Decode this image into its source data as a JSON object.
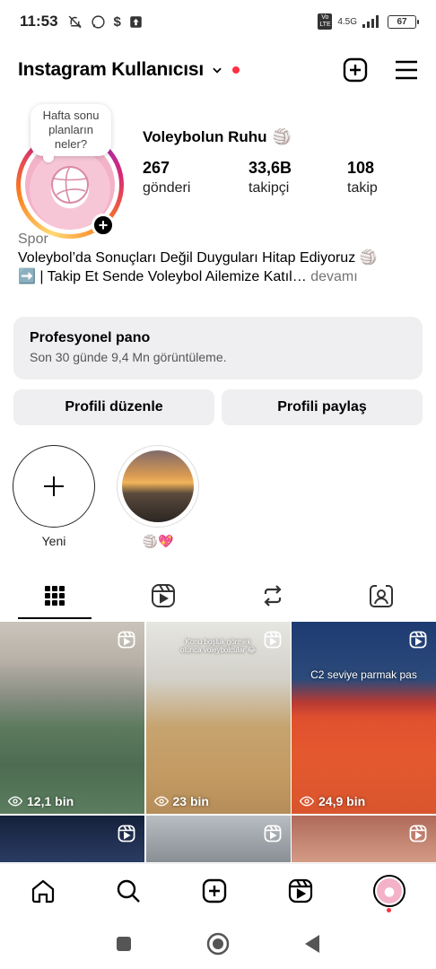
{
  "status_bar": {
    "time": "11:53",
    "network": "4.5G",
    "lte": "Vo LTE",
    "battery": "67"
  },
  "header": {
    "username": "Instagram Kullanıcısı",
    "notification_dot_color": "#ff3040"
  },
  "profile": {
    "note": "Hafta sonu planların neler?",
    "display_name": "Voleybolun Ruhu",
    "display_emoji": "🏐",
    "stats": [
      {
        "value": "267",
        "label": "gönderi"
      },
      {
        "value": "33,6B",
        "label": "takipçi"
      },
      {
        "value": "108",
        "label": "takip"
      }
    ],
    "category": "Spor",
    "bio_line1": "Voleybol’da Sonuçları Değil Duyguları Hitap Ediyoruz 🏐",
    "bio_line2": "➡️ | Takip Et Sende Voleybol Ailemize Katıl…",
    "more": "devamı"
  },
  "professional_dashboard": {
    "title": "Profesyonel pano",
    "subtitle": "Son 30 günde 9,4 Mn görüntüleme."
  },
  "buttons": {
    "edit_profile": "Profili düzenle",
    "share_profile": "Profili paylaş"
  },
  "highlights": [
    {
      "label": "Yeni",
      "icon": "plus-icon"
    },
    {
      "label": "🏐💖",
      "icon": "sunset-image"
    }
  ],
  "tabs": [
    {
      "name": "grid",
      "icon": "grid-icon",
      "active": true
    },
    {
      "name": "reels",
      "icon": "reels-icon",
      "active": false
    },
    {
      "name": "reposts",
      "icon": "repost-icon",
      "active": false
    },
    {
      "name": "tagged",
      "icon": "tagged-icon",
      "active": false
    }
  ],
  "posts": [
    {
      "views": "12,1 bin",
      "caption": ""
    },
    {
      "views": "23 bin",
      "caption": "Konu boşluk görmek olunca voleybolcular 😂"
    },
    {
      "views": "24,9 bin",
      "caption": "C2 seviye parmak pas"
    },
    {
      "views": "",
      "caption": ""
    },
    {
      "views": "",
      "caption": ""
    },
    {
      "views": "",
      "caption": ""
    }
  ],
  "bottom_nav": [
    "home-icon",
    "search-icon",
    "create-icon",
    "reels-icon",
    "profile-avatar"
  ]
}
